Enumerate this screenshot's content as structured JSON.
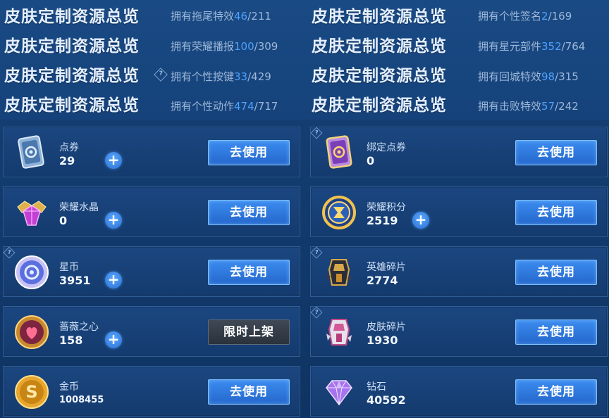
{
  "summary": {
    "title": "皮肤定制资源总览",
    "left": [
      {
        "label": "拥有拖尾特效",
        "owned": "46",
        "total": "/211"
      },
      {
        "label": "拥有荣耀播报",
        "owned": "100",
        "total": "/309"
      },
      {
        "label": "拥有个性按键",
        "owned": "33",
        "total": "/429"
      },
      {
        "label": "拥有个性动作",
        "owned": "474",
        "total": "/717"
      }
    ],
    "right": [
      {
        "label": "拥有个性签名",
        "owned": "2",
        "total": "/169"
      },
      {
        "label": "拥有星元部件",
        "owned": "352",
        "total": "/764"
      },
      {
        "label": "拥有回城特效",
        "owned": "98",
        "total": "/315"
      },
      {
        "label": "拥有击败特效",
        "owned": "57",
        "total": "/242"
      }
    ],
    "help_mark": "?"
  },
  "resources": {
    "use_label": "去使用",
    "limited_label": "限时上架",
    "plus_label": "+",
    "left": [
      {
        "name": "点券",
        "count": "29",
        "icon": "coupon-card-icon"
      },
      {
        "name": "荣耀水晶",
        "count": "0",
        "icon": "glory-crystal-icon"
      },
      {
        "name": "星币",
        "count": "3951",
        "icon": "star-coin-icon"
      },
      {
        "name": "蔷薇之心",
        "count": "158",
        "icon": "rose-heart-icon"
      },
      {
        "name": "金币",
        "count": "1008455",
        "icon": "gold-coin-icon"
      }
    ],
    "right": [
      {
        "name": "绑定点券",
        "count": "0",
        "icon": "bound-coupon-card-icon"
      },
      {
        "name": "荣耀积分",
        "count": "2519",
        "icon": "glory-points-icon"
      },
      {
        "name": "英雄碎片",
        "count": "2774",
        "icon": "hero-fragment-icon"
      },
      {
        "name": "皮肤碎片",
        "count": "1930",
        "icon": "skin-fragment-icon"
      },
      {
        "name": "钻石",
        "count": "40592",
        "icon": "diamond-icon"
      }
    ]
  },
  "colors": {
    "accent_blue": "#4ea1ff",
    "button_blue": "#2467cc",
    "button_disabled": "#2a323c"
  }
}
